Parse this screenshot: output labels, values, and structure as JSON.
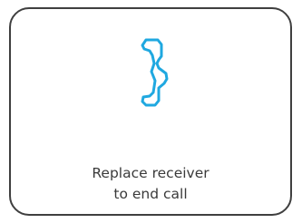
{
  "dialog": {
    "icon": "phone-handset-icon",
    "accent_color": "#1fa8e0",
    "message_line1": "Replace receiver",
    "message_line2": "to end call"
  }
}
